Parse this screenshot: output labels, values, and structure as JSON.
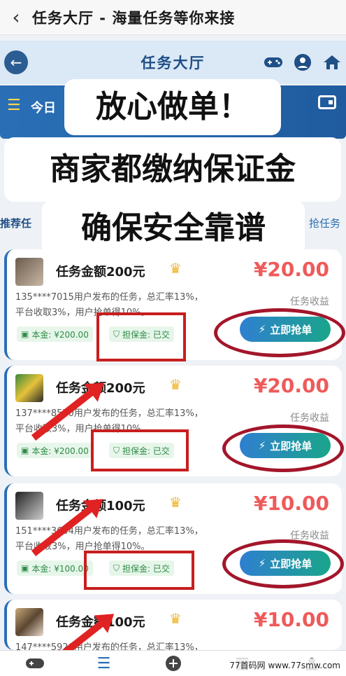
{
  "outer_bar": {
    "back_icon": "chevron-left-icon",
    "title": "任务大厅 - 海量任务等你来接"
  },
  "app_header": {
    "title": "任务大厅",
    "icons": [
      "gamepad-icon",
      "user-circle-icon",
      "home-icon"
    ]
  },
  "today_bar": {
    "label": "今日"
  },
  "captions": [
    "放心做单！",
    "商家都缴纳保证金",
    "确保安全靠谱"
  ],
  "tabs": {
    "left": "推荐任",
    "right": "抢任务"
  },
  "tasks": [
    {
      "title": "任务金额200元",
      "amount": "¥20.00",
      "desc_line1": "135****7015用户发布的任务，总汇率13%，",
      "desc_line2": "平台收取3%，用户抢单得10%。",
      "earn_label": "任务收益",
      "principal": "本金: ¥200.00",
      "deposit": "担保金: 已交",
      "button": "立即抢单"
    },
    {
      "title": "任务金额200元",
      "amount": "¥20.00",
      "desc_line1": "137****8570用户发布的任务，总汇率13%，",
      "desc_line2": "平台收取3%，用户抢单得10%。",
      "earn_label": "任务收益",
      "principal": "本金: ¥200.00",
      "deposit": "担保金: 已交",
      "button": "立即抢单"
    },
    {
      "title": "任务金额100元",
      "amount": "¥10.00",
      "desc_line1": "151****3604用户发布的任务，总汇率13%，",
      "desc_line2": "平台收取3%，用户抢单得10%。",
      "earn_label": "任务收益",
      "principal": "本金: ¥100.00",
      "deposit": "担保金: 已交",
      "button": "立即抢单"
    },
    {
      "title": "任务金额100元",
      "amount": "¥10.00",
      "desc_line1": "147****5920用户发布的任务，总汇率13%，",
      "desc_line2": "",
      "earn_label": "",
      "principal": "",
      "deposit": "",
      "button": ""
    }
  ],
  "bottom_nav": [
    "gamepad-icon",
    "task-list-icon",
    "plus-circle-icon",
    "image-icon",
    "user-icon"
  ],
  "watermark": "77首码网 www.77smw.com",
  "colors": {
    "accent": "#2a6fb6",
    "price": "#ef5a5a",
    "annotation": "#c81e1e"
  }
}
